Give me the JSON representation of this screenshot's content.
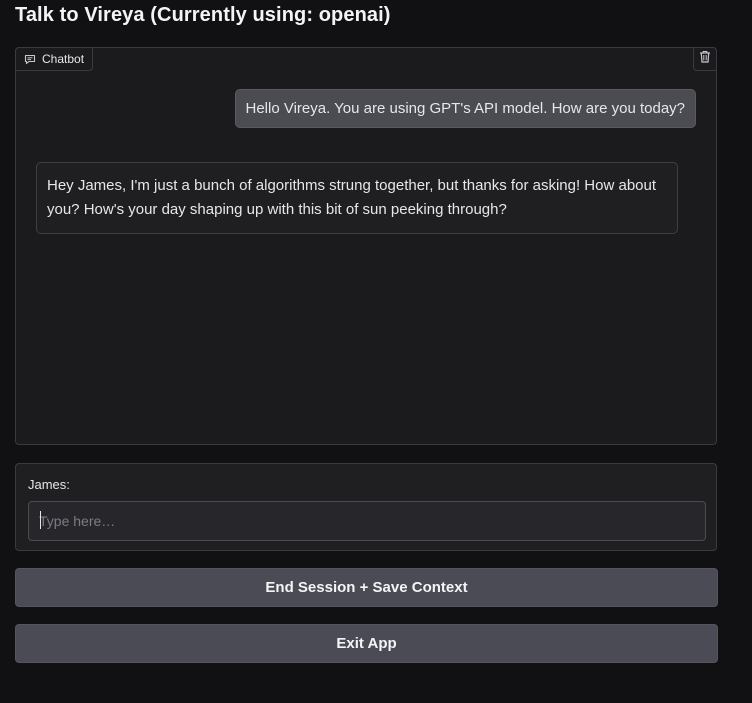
{
  "page": {
    "title": "Talk to Vireya (Currently using: openai)"
  },
  "chatbot": {
    "label": "Chatbot",
    "icons": {
      "label_icon": "chat-bubble-icon",
      "clear_icon": "trash-icon"
    },
    "messages": [
      {
        "role": "user",
        "text": "Hello Vireya. You are using GPT's API model. How are you today?"
      },
      {
        "role": "assistant",
        "text": "Hey James, I'm just a bunch of algorithms strung together, but thanks for asking! How about you? How's your day shaping up with this bit of sun peeking through?"
      }
    ]
  },
  "input": {
    "label": "James:",
    "value": "",
    "placeholder": "Type here…"
  },
  "buttons": {
    "end_session": "End Session + Save Context",
    "exit_app": "Exit App"
  },
  "colors": {
    "background": "#111114",
    "panel": "#1b1b1e",
    "user_bubble": "#4b4b52",
    "button": "#4b4b55"
  }
}
